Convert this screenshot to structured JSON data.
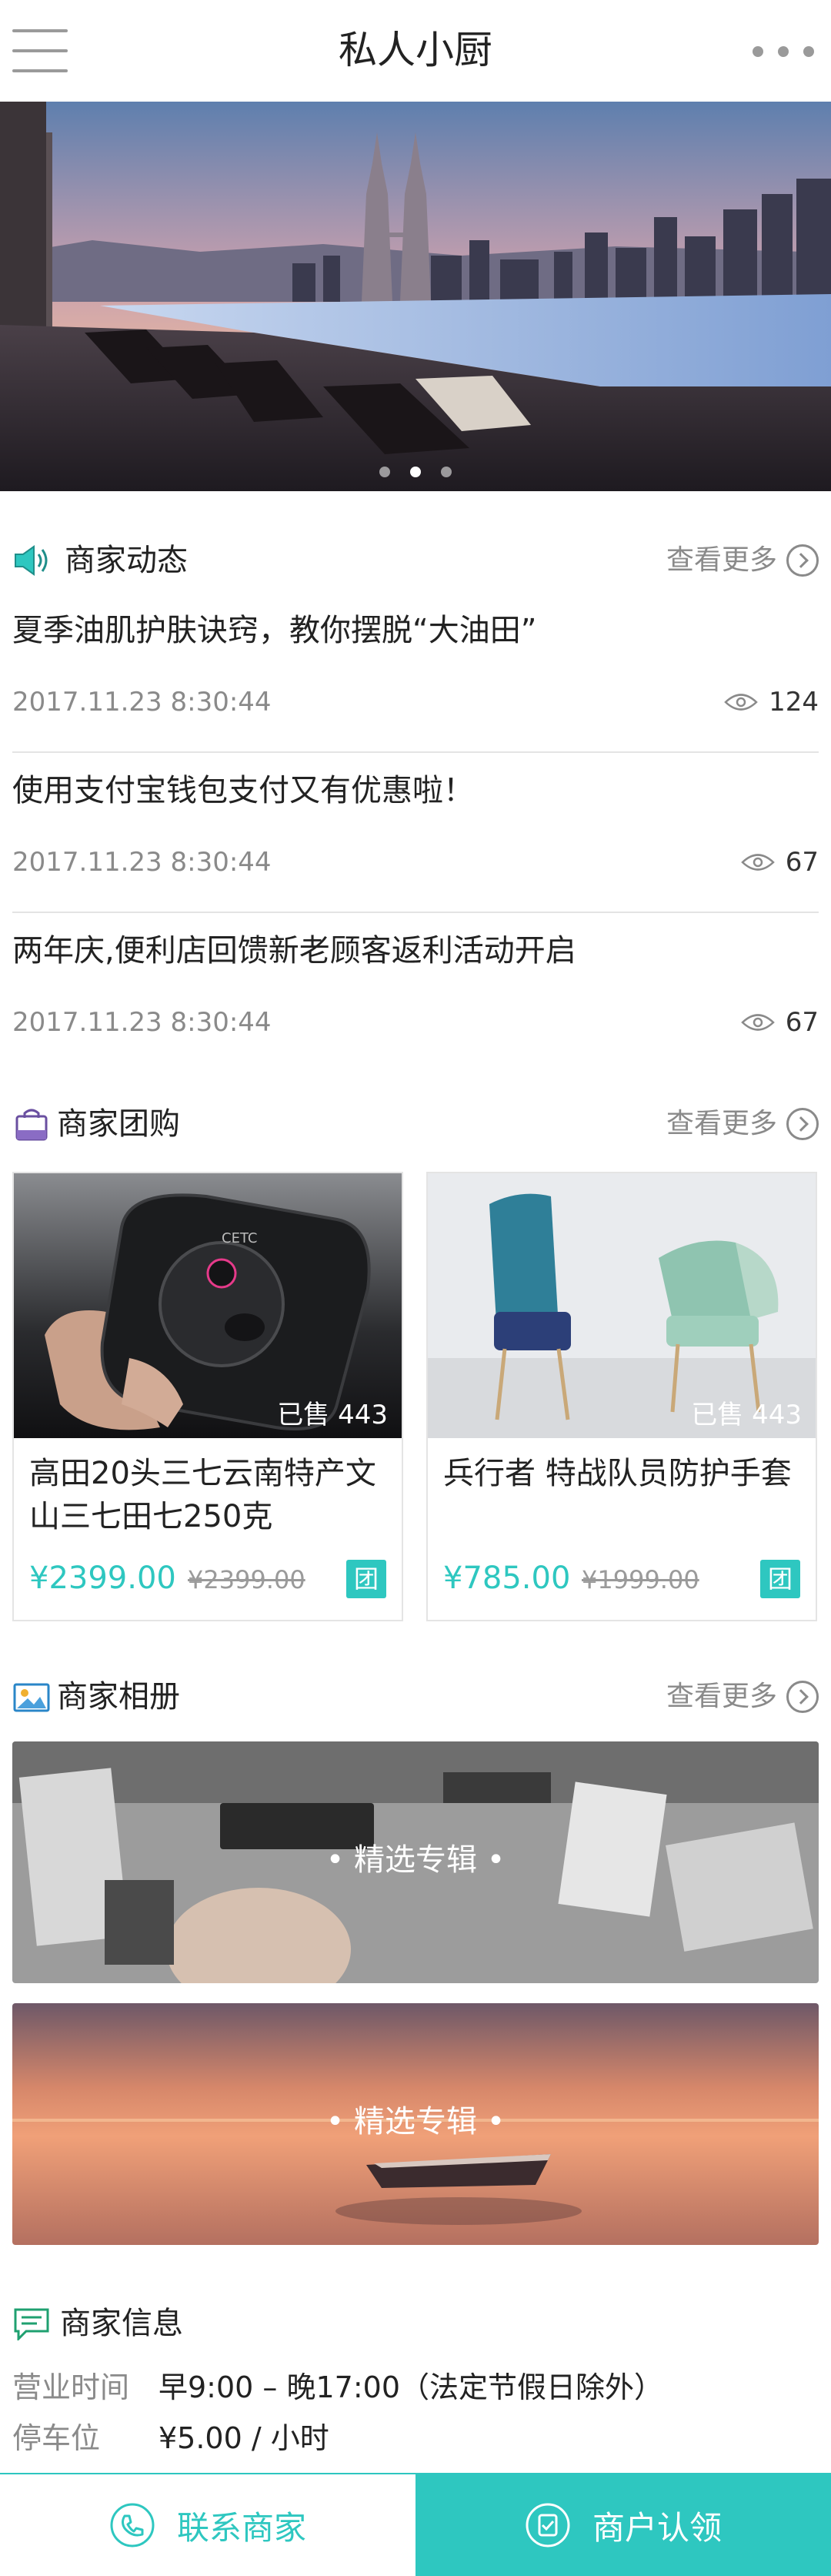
{
  "header": {
    "title": "私人小厨"
  },
  "banner": {
    "slide_count": 3,
    "active_index": 1
  },
  "news": {
    "section_title": "商家动态",
    "more_label": "查看更多",
    "items": [
      {
        "title": "夏季油肌护肤诀窍，教你摆脱“大油田”",
        "date": "2017.11.23   8:30:44",
        "views": "124"
      },
      {
        "title": "使用支付宝钱包支付又有优惠啦！",
        "date": "2017.11.23   8:30:44",
        "views": "67"
      },
      {
        "title": "两年庆,便利店回馈新老顾客返利活动开启",
        "date": "2017.11.23   8:30:44",
        "views": "67"
      }
    ]
  },
  "group": {
    "section_title": "商家团购",
    "more_label": "查看更多",
    "items": [
      {
        "name": "高田20头三七云南特产文山三七田七250克",
        "sold": "已售 443",
        "price": "¥2399.00",
        "old_price": "¥2399.00",
        "badge": "团"
      },
      {
        "name": "兵行者 特战队员防护手套",
        "sold": "已售 443",
        "price": "¥785.00",
        "old_price": "¥1999.00",
        "badge": "团"
      }
    ]
  },
  "album": {
    "section_title": "商家相册",
    "more_label": "查看更多",
    "items": [
      {
        "caption": "•  精选专辑  •"
      },
      {
        "caption": "•  精选专辑  •"
      }
    ]
  },
  "info": {
    "section_title": "商家信息",
    "rows": [
      {
        "key": "营业时间",
        "value": "早9:00 – 晚17:00（法定节假日除外）"
      },
      {
        "key": "停车位",
        "value": "¥5.00 / 小时"
      }
    ]
  },
  "bottom": {
    "contact_label": "联系商家",
    "verify_label": "商户认领"
  },
  "colors": {
    "accent": "#2ec7c0",
    "muted": "#8a8a8a"
  }
}
